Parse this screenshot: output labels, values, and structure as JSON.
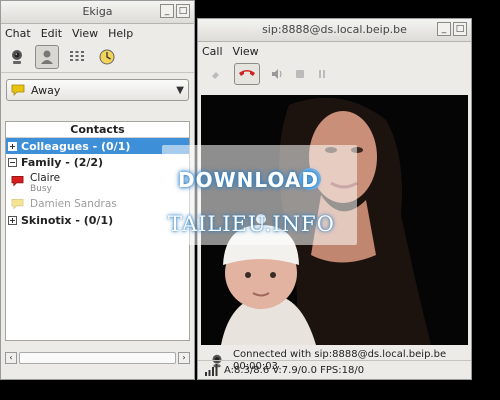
{
  "ekiga": {
    "title": "Ekiga",
    "window_buttons": [
      "_",
      "□"
    ],
    "menu": [
      "Chat",
      "Edit",
      "View",
      "Help"
    ],
    "toolbar_icons": [
      "webcam-icon",
      "contacts-icon",
      "dialpad-icon",
      "call-history-icon"
    ],
    "presence": {
      "value": "Away",
      "icon_color": "#e8c40f"
    },
    "contacts_header": "Contacts",
    "groups": [
      {
        "label": "Colleagues - (0/1)",
        "expander": "+",
        "selected": true
      },
      {
        "label": "Family - (2/2)",
        "expander": "−",
        "selected": false
      },
      {
        "label": "Skinotix - (0/1)",
        "expander": "+",
        "selected": false
      }
    ],
    "family_contacts": [
      {
        "name": "Claire",
        "status": "Busy",
        "icon_color": "#d62020"
      },
      {
        "name": "Damien Sandras",
        "status": "",
        "icon_color": "#e8c40f"
      }
    ],
    "scroll_left": "‹",
    "scroll_right": "›"
  },
  "call": {
    "title": "sip:8888@ds.local.beip.be",
    "window_buttons": [
      "_",
      "□"
    ],
    "menu": [
      "Call",
      "View"
    ],
    "status_line1": "Connected with sip:8888@ds.local.beip.be",
    "status_line2": "00:00:03",
    "stats": "A:8.3/8.6 V:7.9/0.0 FPS:18/0"
  },
  "watermark": {
    "line1": "DOWNLOAD",
    "line2": "TAILIEU.INFO"
  },
  "colors": {
    "selection": "#3d8fd8",
    "hangup": "#cc2222",
    "busy": "#d62020",
    "away": "#e8c40f"
  }
}
